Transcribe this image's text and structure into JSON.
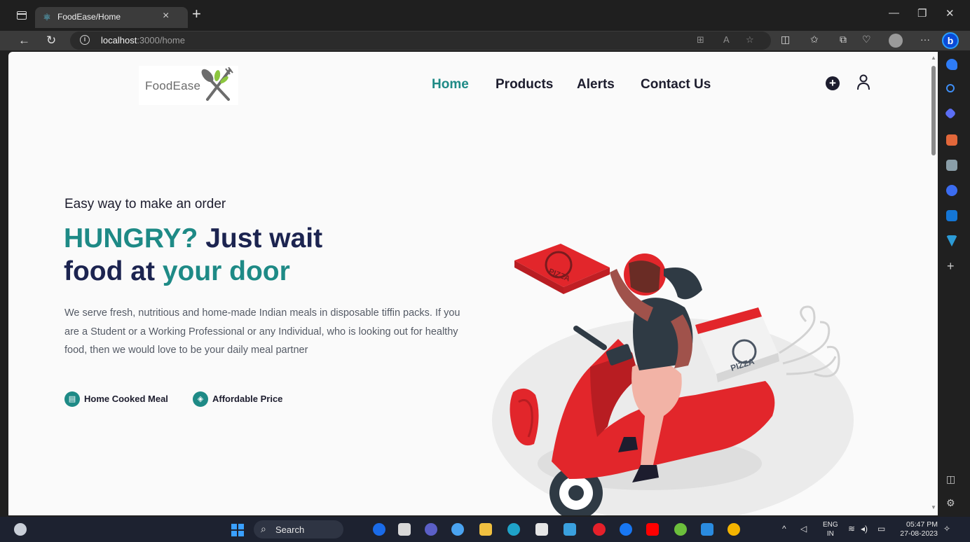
{
  "browser": {
    "tab_title": "FoodEase/Home",
    "url_host": "localhost",
    "url_rest": ":3000/home"
  },
  "site": {
    "logo_text": "FoodEase",
    "nav": [
      "Home",
      "Products",
      "Alerts",
      "Contact Us"
    ]
  },
  "hero": {
    "eyebrow": "Easy way to make an order",
    "title_part1": "HUNGRY?",
    "title_part2": " Just wait",
    "title_part3": "food at ",
    "title_part4": "your door",
    "description": "We serve fresh, nutritious and home-made Indian meals in disposable tiffin packs. If you are a Student or a Working Professional or any Individual, who is looking out for healthy food, then we would love to be your daily meal partner",
    "features": [
      "Home Cooked Meal",
      "Affordable Price"
    ],
    "illustration_text": [
      "PIZZA",
      "PIZZA"
    ]
  },
  "taskbar": {
    "search_label": "Search",
    "lang_top": "ENG",
    "lang_bottom": "IN",
    "time": "05:47 PM",
    "date": "27-08-2023"
  },
  "colors": {
    "teal": "#1e8a86",
    "navy": "#1c2450",
    "scooter_red": "#e2262b"
  }
}
